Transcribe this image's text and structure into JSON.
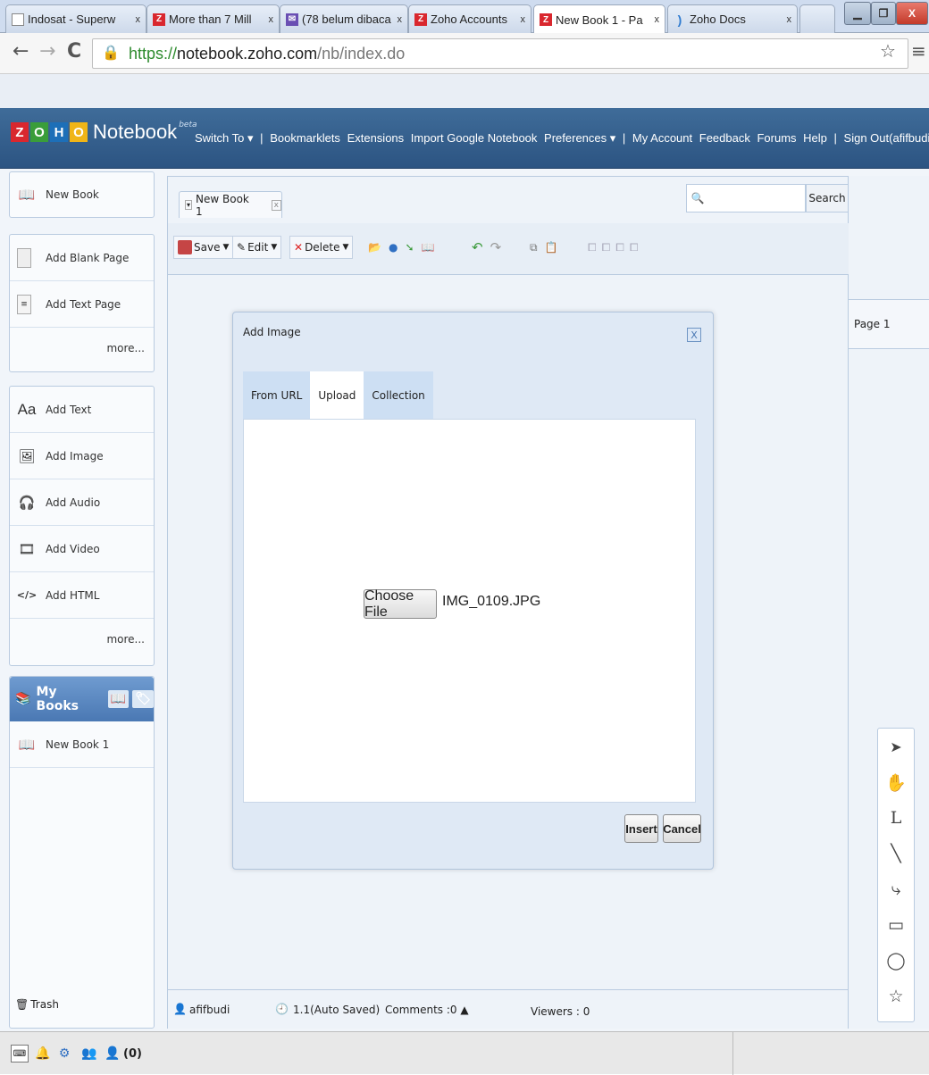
{
  "browser": {
    "tabs": [
      {
        "title": "Indosat - Superw",
        "icon": "page-icon"
      },
      {
        "title": "More than 7 Mill",
        "icon": "zoho-icon"
      },
      {
        "title": "(78 belum dibaca",
        "icon": "mail-icon"
      },
      {
        "title": "Zoho Accounts",
        "icon": "zoho-icon"
      },
      {
        "title": "New Book 1 - Pa",
        "icon": "zoho-icon"
      },
      {
        "title": "Zoho Docs",
        "icon": "docs-icon"
      }
    ],
    "tab_close": "x",
    "url_scheme": "https://",
    "url_host": "notebook.zoho.com",
    "url_path": "/nb/index.do"
  },
  "header": {
    "logo_letters": [
      "Z",
      "O",
      "H",
      "O"
    ],
    "logo_colors": [
      "#d9272e",
      "#3a9d3a",
      "#1d6fb8",
      "#f0b517"
    ],
    "product": "Notebook",
    "beta": "beta",
    "nav": [
      "Switch To ▾",
      "|",
      "Bookmarklets",
      "Extensions",
      "Import Google Notebook",
      "Preferences ▾",
      "|",
      "My Account",
      "Feedback",
      "Forums",
      "Help",
      "|",
      "Sign Out(afifbudi)"
    ]
  },
  "sidebar": {
    "new_book": "New Book",
    "pages": [
      {
        "label": "Add Blank Page",
        "icon": "blank-page-icon"
      },
      {
        "label": "Add Text Page",
        "icon": "text-page-icon"
      }
    ],
    "pages_more": "more...",
    "content": [
      {
        "label": "Add Text",
        "icon": "text-icon",
        "glyph": "Aa"
      },
      {
        "label": "Add Image",
        "icon": "image-icon",
        "glyph": "🖼"
      },
      {
        "label": "Add Audio",
        "icon": "audio-icon",
        "glyph": "🎧"
      },
      {
        "label": "Add Video",
        "icon": "video-icon",
        "glyph": "🎞"
      },
      {
        "label": "Add HTML",
        "icon": "html-icon",
        "glyph": "</>"
      }
    ],
    "content_more": "more...",
    "my_books_title": "My Books",
    "books": [
      "New Book 1"
    ],
    "trash": "Trash"
  },
  "main": {
    "doc_tab": "New Book 1",
    "search_button": "Search",
    "toolbar": {
      "save": "Save",
      "edit": "Edit",
      "delete": "Delete"
    },
    "status": {
      "user": "afifbudi",
      "version": "1.1(Auto Saved)",
      "comments": "Comments :0 ▲",
      "viewers": "Viewers : 0"
    }
  },
  "dialog": {
    "title": "Add Image",
    "close": "X",
    "tabs": [
      "From URL",
      "Upload",
      "Collection"
    ],
    "active_tab": "Upload",
    "choose_file": "Choose File",
    "file_name": "IMG_0109.JPG",
    "insert": "Insert",
    "cancel": "Cancel"
  },
  "right": {
    "page_label": "Page 1",
    "tools": [
      "select-arrow-icon",
      "hand-icon",
      "text-cursor-icon",
      "line-icon",
      "connector-icon",
      "rectangle-icon",
      "ellipse-icon",
      "star-icon"
    ]
  },
  "taskbar": {
    "count": "(0)"
  }
}
